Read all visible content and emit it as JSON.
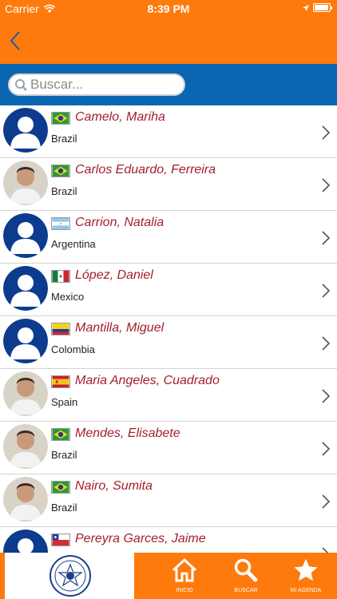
{
  "status_bar": {
    "carrier": "Carrier",
    "time": "8:39 PM",
    "battery_level": 0.95
  },
  "search": {
    "placeholder": "Buscar..."
  },
  "contacts": [
    {
      "name": "Camelo, Mariha",
      "country": "Brazil",
      "flag": "brazil-flag",
      "avatar": "default-avatar"
    },
    {
      "name": "Carlos Eduardo, Ferreira",
      "country": "Brazil",
      "flag": "brazil-flag",
      "avatar": "photo-avatar"
    },
    {
      "name": "Carrion, Natalia",
      "country": "Argentina",
      "flag": "argentina-flag",
      "avatar": "default-avatar"
    },
    {
      "name": "López, Daniel",
      "country": "Mexico",
      "flag": "mexico-flag",
      "avatar": "default-avatar"
    },
    {
      "name": "Mantilla, Miguel",
      "country": "Colombia",
      "flag": "colombia-flag",
      "avatar": "default-avatar"
    },
    {
      "name": "Maria Angeles, Cuadrado",
      "country": "Spain",
      "flag": "spain-flag",
      "avatar": "photo-avatar"
    },
    {
      "name": "Mendes, Elisabete",
      "country": "Brazil",
      "flag": "brazil-flag",
      "avatar": "photo-avatar"
    },
    {
      "name": "Nairo, Sumita",
      "country": "Brazil",
      "flag": "brazil-flag",
      "avatar": "photo-avatar"
    },
    {
      "name": "Pereyra Garces, Jaime",
      "country": "",
      "flag": "chile-flag",
      "avatar": "default-avatar"
    }
  ],
  "tabs": [
    {
      "label": "INICIO",
      "icon": "home-icon"
    },
    {
      "label": "BUSCAR",
      "icon": "search-icon"
    },
    {
      "label": "MI AGENDA",
      "icon": "star-icon"
    }
  ],
  "colors": {
    "accent": "#ff7a0c",
    "search_bar": "#0a66b1",
    "name_text": "#a31f2c",
    "avatar_blue": "#0d3b8e"
  }
}
